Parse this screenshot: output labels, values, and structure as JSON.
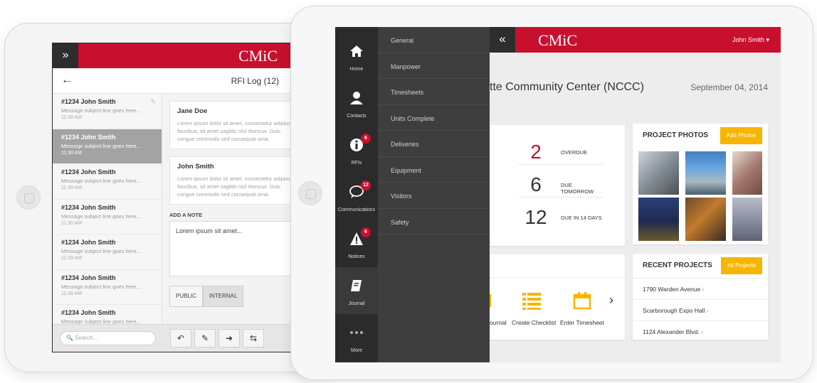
{
  "left_tablet": {
    "brand": "CMiC",
    "title": "RFI Log (12)",
    "messages": [
      {
        "from": "#1234 John Smith",
        "preview": "Message subject line goes here...",
        "time": "11:30 AM",
        "selected": false
      },
      {
        "from": "#1234  John Smith",
        "preview": "Message subject line goes here...",
        "time": "11:30 AM",
        "selected": true
      },
      {
        "from": "#1234 John Smith",
        "preview": "Message subject line goes here...",
        "time": "11:30 AM",
        "selected": false
      },
      {
        "from": "#1234 John Smith",
        "preview": "Message subject line goes here...",
        "time": "11:30 AM",
        "selected": false
      },
      {
        "from": "#1234 John Smith",
        "preview": "Message subject line goes here...",
        "time": "11:30 AM",
        "selected": false
      },
      {
        "from": "#1234 John Smith",
        "preview": "Message subject line goes here...",
        "time": "11:30 AM",
        "selected": false
      },
      {
        "from": "#1234 John Smith",
        "preview": "Message subject line goes here...",
        "time": "",
        "selected": false
      }
    ],
    "comments": [
      {
        "name": "Jane Doe",
        "lines": [
          "Lorem ipsum dolor sit amet, consectetur adipiscing",
          "faucibus, sit amet sagittis nisl rhoncus. Duis",
          "congue commodo sed consequat urna."
        ]
      },
      {
        "name": "John Smith",
        "lines": [
          "Lorem ipsum dolor sit amet, consectetur adipiscing",
          "faucibus, sit amet sagittis nisl rhoncus. Duis",
          "congue commodo sed consequat urna."
        ]
      }
    ],
    "add_note_label": "ADD A NOTE",
    "note_value": "Lorem ipsum sit amet...",
    "visibility": {
      "public": "PUBLIC",
      "internal": "INTERNAL"
    },
    "search_placeholder": "Search..."
  },
  "right_tablet": {
    "brand": "CMiC",
    "user": "John Smith ▾",
    "nav": [
      {
        "label": "Home",
        "icon": "home-icon",
        "badge": ""
      },
      {
        "label": "Contacts",
        "icon": "contact-icon",
        "badge": ""
      },
      {
        "label": "RFIs",
        "icon": "info-icon",
        "badge": "6"
      },
      {
        "label": "Communications",
        "icon": "chat-icon",
        "badge": "12"
      },
      {
        "label": "Notices",
        "icon": "warning-icon",
        "badge": "6"
      },
      {
        "label": "Journal",
        "icon": "journal-icon",
        "badge": ""
      },
      {
        "label": "More",
        "icon": "more-icon",
        "badge": ""
      }
    ],
    "sub_nav": [
      "General",
      "Manpower",
      "Timesheets",
      "Units Complete",
      "Deliveries",
      "Equipment",
      "Visitors",
      "Safety"
    ],
    "project_title": "tte Community Center (NCCC)",
    "date": "September 04, 2014",
    "due": [
      {
        "count": "2",
        "label": "OVERDUE",
        "highlight": true
      },
      {
        "count": "6",
        "label": "DUE TOMORROW",
        "highlight": false
      },
      {
        "count": "12",
        "label": "DUE IN 14 DAYS",
        "highlight": false
      }
    ],
    "actions": [
      "ournal",
      "Create Checklist",
      "Enter Timesheet"
    ],
    "photos": {
      "title": "PROJECT PHOTOS",
      "button": "Add Photos"
    },
    "recent": {
      "title": "RECENT PROJECTS",
      "button": "All Projects",
      "items": [
        "1790 Warden Avenue",
        "Scarborough Expo Hall",
        "1124 Alexander Blvd."
      ]
    },
    "colors": {
      "brand_red": "#c8102e",
      "accent_yellow": "#f7b500",
      "nav_dark": "#2b2b2b"
    }
  }
}
